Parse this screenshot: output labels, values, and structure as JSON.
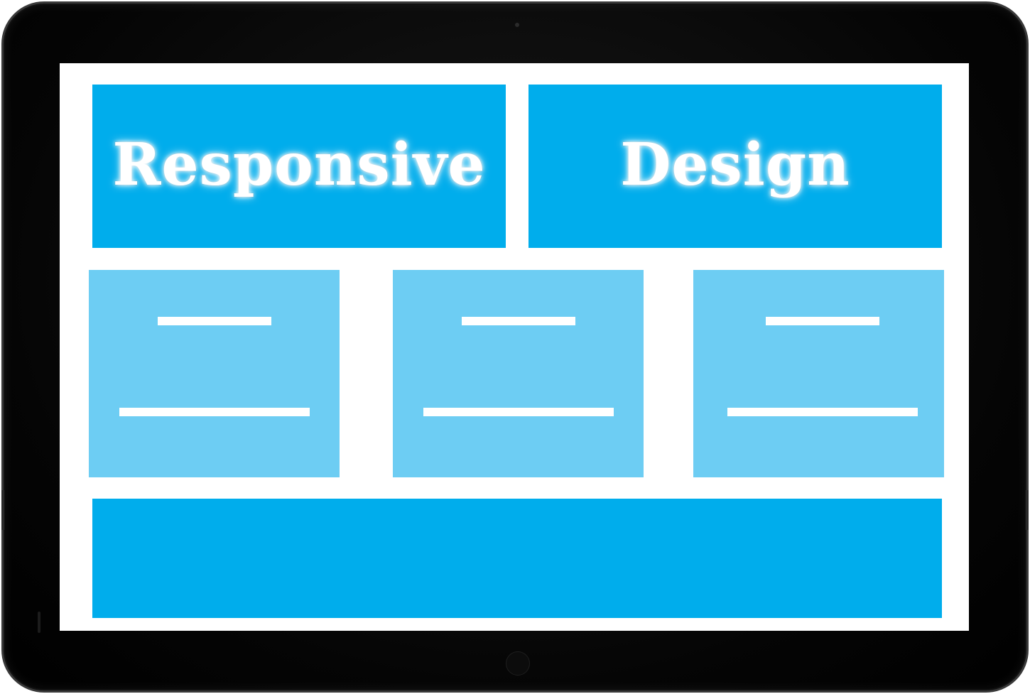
{
  "hero": {
    "left_word": "Responsive",
    "right_word": "Design"
  },
  "cards": [
    {
      "id": 1
    },
    {
      "id": 2
    },
    {
      "id": 3
    }
  ],
  "colors": {
    "primary_blue": "#00adec",
    "light_blue": "#6dcdf3",
    "screen_bg": "#ffffff",
    "device_body": "#000000"
  }
}
